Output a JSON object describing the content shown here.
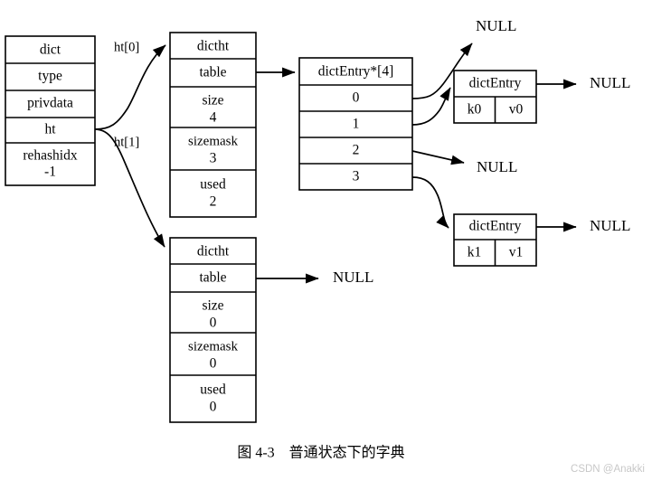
{
  "figure": {
    "caption": "图 4-3　普通状态下的字典",
    "watermark": "CSDN @Anakki",
    "colors": {
      "stroke": "#000000",
      "background": "#ffffff",
      "watermark": "#c8c8c8"
    }
  },
  "dict_struct": {
    "title": "dict",
    "fields": [
      {
        "name": "type",
        "value": ""
      },
      {
        "name": "privdata",
        "value": ""
      },
      {
        "name": "ht",
        "value": ""
      },
      {
        "name": "rehashidx",
        "value": "-1"
      }
    ]
  },
  "edge_labels": {
    "ht0": "ht[0]",
    "ht1": "ht[1]"
  },
  "hashtables": [
    {
      "title": "dictht",
      "table_label": "table",
      "size_label": "size",
      "size_value": "4",
      "sizemask_label": "sizemask",
      "sizemask_value": "3",
      "used_label": "used",
      "used_value": "2"
    },
    {
      "title": "dictht",
      "table_label": "table",
      "size_label": "size",
      "size_value": "0",
      "sizemask_label": "sizemask",
      "sizemask_value": "0",
      "used_label": "used",
      "used_value": "0"
    }
  ],
  "bucket_array": {
    "title": "dictEntry*[4]",
    "indexes": [
      "0",
      "1",
      "2",
      "3"
    ]
  },
  "entries": [
    {
      "title": "dictEntry",
      "key": "k0",
      "value": "v0",
      "next": "NULL"
    },
    {
      "title": "dictEntry",
      "key": "k1",
      "value": "v1",
      "next": "NULL"
    }
  ],
  "nulls": {
    "bucket0": "NULL",
    "bucket2": "NULL",
    "ht1_table": "NULL"
  },
  "chart_data": {
    "type": "diagram",
    "title": "图 4-3　普通状态下的字典",
    "nodes": [
      {
        "id": "dict",
        "label": "dict",
        "fields": [
          "type",
          "privdata",
          "ht",
          "rehashidx -1"
        ]
      },
      {
        "id": "ht0",
        "label": "dictht",
        "fields": [
          "table",
          "size 4",
          "sizemask 3",
          "used 2"
        ]
      },
      {
        "id": "ht1",
        "label": "dictht",
        "fields": [
          "table",
          "size 0",
          "sizemask 0",
          "used 0"
        ]
      },
      {
        "id": "bucketarray",
        "label": "dictEntry*[4]",
        "fields": [
          "0",
          "1",
          "2",
          "3"
        ]
      },
      {
        "id": "entry0",
        "label": "dictEntry",
        "fields": [
          "k0",
          "v0"
        ]
      },
      {
        "id": "entry1",
        "label": "dictEntry",
        "fields": [
          "k1",
          "v1"
        ]
      }
    ],
    "edges": [
      {
        "from": "dict.ht",
        "to": "ht0",
        "label": "ht[0]"
      },
      {
        "from": "dict.ht",
        "to": "ht1",
        "label": "ht[1]"
      },
      {
        "from": "ht0.table",
        "to": "bucketarray",
        "label": ""
      },
      {
        "from": "bucketarray.0",
        "to": "NULL",
        "label": ""
      },
      {
        "from": "bucketarray.1",
        "to": "entry0",
        "label": ""
      },
      {
        "from": "bucketarray.2",
        "to": "NULL",
        "label": ""
      },
      {
        "from": "bucketarray.3",
        "to": "entry1",
        "label": ""
      },
      {
        "from": "entry0",
        "to": "NULL",
        "label": ""
      },
      {
        "from": "entry1",
        "to": "NULL",
        "label": ""
      },
      {
        "from": "ht1.table",
        "to": "NULL",
        "label": ""
      }
    ]
  }
}
